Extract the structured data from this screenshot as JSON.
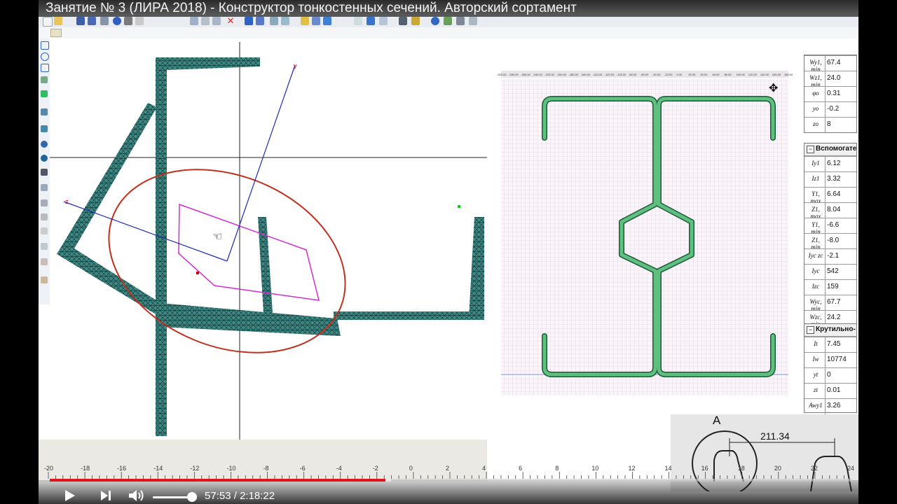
{
  "video": {
    "title": "Занятие № 3 (ЛИРА 2018) - Конструктор тонкостенных сечений. Авторский сортамент",
    "current_time": "57:53",
    "separator": "/",
    "duration": "2:18:22",
    "progress": 0.418,
    "buffered": 0.425,
    "volume": 0.85,
    "accent_color": "#e2151a"
  },
  "left_canvas": {
    "axis_y_label": "y",
    "axis_z_label": "z"
  },
  "ruler": {
    "ticks": [
      "-20",
      "-18",
      "-16",
      "-14",
      "-12",
      "-10",
      "-8",
      "-6",
      "-4",
      "-2",
      "0",
      "2",
      "4",
      "6",
      "8",
      "10",
      "12",
      "14",
      "16",
      "18",
      "20",
      "22",
      "24"
    ]
  },
  "right_canvas": {
    "top_scale": [
      "-300.00",
      "-280.00",
      "-260.00",
      "-240.00",
      "-220.00",
      "-200.00",
      "-180.00",
      "-160.00",
      "-140.00",
      "-120.00",
      "-100.00",
      "-80.00",
      "-60.00",
      "-40.00",
      "-20.00",
      "0.00",
      "20.00",
      "40.00",
      "60.00",
      "80.00",
      "100.00",
      "120.00",
      "140.00",
      "160.00",
      "180.00"
    ]
  },
  "properties": {
    "group1_rows": [
      {
        "name": "Wy1, min",
        "value": "67.4"
      },
      {
        "name": "Wz1, min",
        "value": "24.0"
      },
      {
        "name": "φo",
        "value": "0.31"
      },
      {
        "name": "yo",
        "value": "-0.2"
      },
      {
        "name": "zo",
        "value": "8"
      }
    ],
    "group2_title": "Вспомогате",
    "group2_rows": [
      {
        "name": "Iy1",
        "value": "6.12"
      },
      {
        "name": "Iz1",
        "value": "3.32"
      },
      {
        "name": "Y1, max",
        "value": "6.64"
      },
      {
        "name": "Z1, max",
        "value": "8.04"
      },
      {
        "name": "Y1, min",
        "value": "-6.6"
      },
      {
        "name": "Z1, min",
        "value": "-8.0"
      },
      {
        "name": "Iyc zc",
        "value": "-2.1"
      },
      {
        "name": "Iyc",
        "value": "542"
      },
      {
        "name": "Izc",
        "value": "159"
      },
      {
        "name": "Wyc, min",
        "value": "67.7"
      },
      {
        "name": "Wzc, min",
        "value": "24.2"
      }
    ],
    "group3_title": "Крутильно-",
    "group3_rows": [
      {
        "name": "It",
        "value": "7.45"
      },
      {
        "name": "Iw",
        "value": "10774"
      },
      {
        "name": "yt",
        "value": "0"
      },
      {
        "name": "zt",
        "value": "0.01"
      },
      {
        "name": "Awy1",
        "value": "3.26"
      }
    ]
  },
  "inset": {
    "label_a": "A",
    "dimension": "211.34"
  }
}
